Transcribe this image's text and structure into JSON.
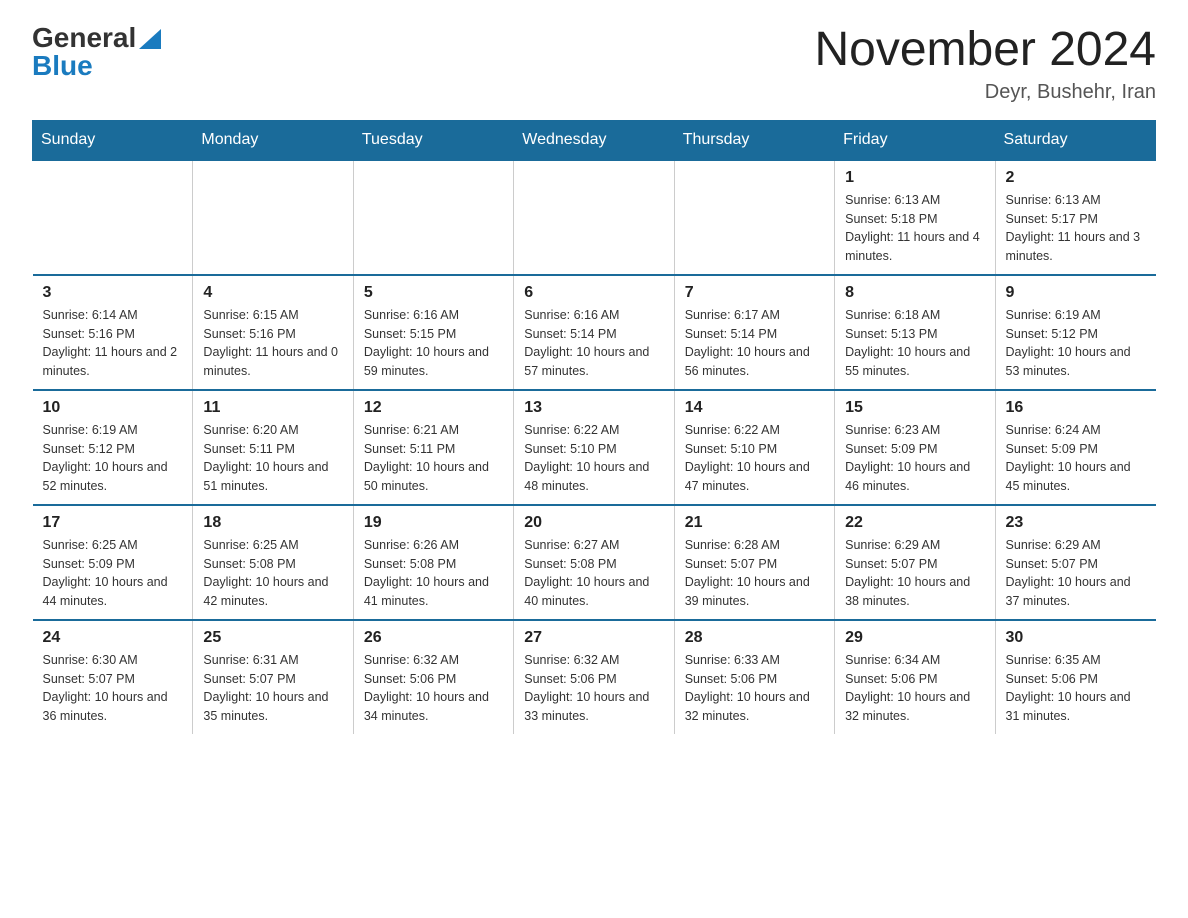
{
  "logo": {
    "text_general": "General",
    "text_blue": "Blue",
    "icon_label": "blue-triangle-icon"
  },
  "header": {
    "month_title": "November 2024",
    "location": "Deyr, Bushehr, Iran"
  },
  "weekdays": [
    "Sunday",
    "Monday",
    "Tuesday",
    "Wednesday",
    "Thursday",
    "Friday",
    "Saturday"
  ],
  "weeks": [
    [
      {
        "day": "",
        "info": ""
      },
      {
        "day": "",
        "info": ""
      },
      {
        "day": "",
        "info": ""
      },
      {
        "day": "",
        "info": ""
      },
      {
        "day": "",
        "info": ""
      },
      {
        "day": "1",
        "info": "Sunrise: 6:13 AM\nSunset: 5:18 PM\nDaylight: 11 hours and 4 minutes."
      },
      {
        "day": "2",
        "info": "Sunrise: 6:13 AM\nSunset: 5:17 PM\nDaylight: 11 hours and 3 minutes."
      }
    ],
    [
      {
        "day": "3",
        "info": "Sunrise: 6:14 AM\nSunset: 5:16 PM\nDaylight: 11 hours and 2 minutes."
      },
      {
        "day": "4",
        "info": "Sunrise: 6:15 AM\nSunset: 5:16 PM\nDaylight: 11 hours and 0 minutes."
      },
      {
        "day": "5",
        "info": "Sunrise: 6:16 AM\nSunset: 5:15 PM\nDaylight: 10 hours and 59 minutes."
      },
      {
        "day": "6",
        "info": "Sunrise: 6:16 AM\nSunset: 5:14 PM\nDaylight: 10 hours and 57 minutes."
      },
      {
        "day": "7",
        "info": "Sunrise: 6:17 AM\nSunset: 5:14 PM\nDaylight: 10 hours and 56 minutes."
      },
      {
        "day": "8",
        "info": "Sunrise: 6:18 AM\nSunset: 5:13 PM\nDaylight: 10 hours and 55 minutes."
      },
      {
        "day": "9",
        "info": "Sunrise: 6:19 AM\nSunset: 5:12 PM\nDaylight: 10 hours and 53 minutes."
      }
    ],
    [
      {
        "day": "10",
        "info": "Sunrise: 6:19 AM\nSunset: 5:12 PM\nDaylight: 10 hours and 52 minutes."
      },
      {
        "day": "11",
        "info": "Sunrise: 6:20 AM\nSunset: 5:11 PM\nDaylight: 10 hours and 51 minutes."
      },
      {
        "day": "12",
        "info": "Sunrise: 6:21 AM\nSunset: 5:11 PM\nDaylight: 10 hours and 50 minutes."
      },
      {
        "day": "13",
        "info": "Sunrise: 6:22 AM\nSunset: 5:10 PM\nDaylight: 10 hours and 48 minutes."
      },
      {
        "day": "14",
        "info": "Sunrise: 6:22 AM\nSunset: 5:10 PM\nDaylight: 10 hours and 47 minutes."
      },
      {
        "day": "15",
        "info": "Sunrise: 6:23 AM\nSunset: 5:09 PM\nDaylight: 10 hours and 46 minutes."
      },
      {
        "day": "16",
        "info": "Sunrise: 6:24 AM\nSunset: 5:09 PM\nDaylight: 10 hours and 45 minutes."
      }
    ],
    [
      {
        "day": "17",
        "info": "Sunrise: 6:25 AM\nSunset: 5:09 PM\nDaylight: 10 hours and 44 minutes."
      },
      {
        "day": "18",
        "info": "Sunrise: 6:25 AM\nSunset: 5:08 PM\nDaylight: 10 hours and 42 minutes."
      },
      {
        "day": "19",
        "info": "Sunrise: 6:26 AM\nSunset: 5:08 PM\nDaylight: 10 hours and 41 minutes."
      },
      {
        "day": "20",
        "info": "Sunrise: 6:27 AM\nSunset: 5:08 PM\nDaylight: 10 hours and 40 minutes."
      },
      {
        "day": "21",
        "info": "Sunrise: 6:28 AM\nSunset: 5:07 PM\nDaylight: 10 hours and 39 minutes."
      },
      {
        "day": "22",
        "info": "Sunrise: 6:29 AM\nSunset: 5:07 PM\nDaylight: 10 hours and 38 minutes."
      },
      {
        "day": "23",
        "info": "Sunrise: 6:29 AM\nSunset: 5:07 PM\nDaylight: 10 hours and 37 minutes."
      }
    ],
    [
      {
        "day": "24",
        "info": "Sunrise: 6:30 AM\nSunset: 5:07 PM\nDaylight: 10 hours and 36 minutes."
      },
      {
        "day": "25",
        "info": "Sunrise: 6:31 AM\nSunset: 5:07 PM\nDaylight: 10 hours and 35 minutes."
      },
      {
        "day": "26",
        "info": "Sunrise: 6:32 AM\nSunset: 5:06 PM\nDaylight: 10 hours and 34 minutes."
      },
      {
        "day": "27",
        "info": "Sunrise: 6:32 AM\nSunset: 5:06 PM\nDaylight: 10 hours and 33 minutes."
      },
      {
        "day": "28",
        "info": "Sunrise: 6:33 AM\nSunset: 5:06 PM\nDaylight: 10 hours and 32 minutes."
      },
      {
        "day": "29",
        "info": "Sunrise: 6:34 AM\nSunset: 5:06 PM\nDaylight: 10 hours and 32 minutes."
      },
      {
        "day": "30",
        "info": "Sunrise: 6:35 AM\nSunset: 5:06 PM\nDaylight: 10 hours and 31 minutes."
      }
    ]
  ]
}
